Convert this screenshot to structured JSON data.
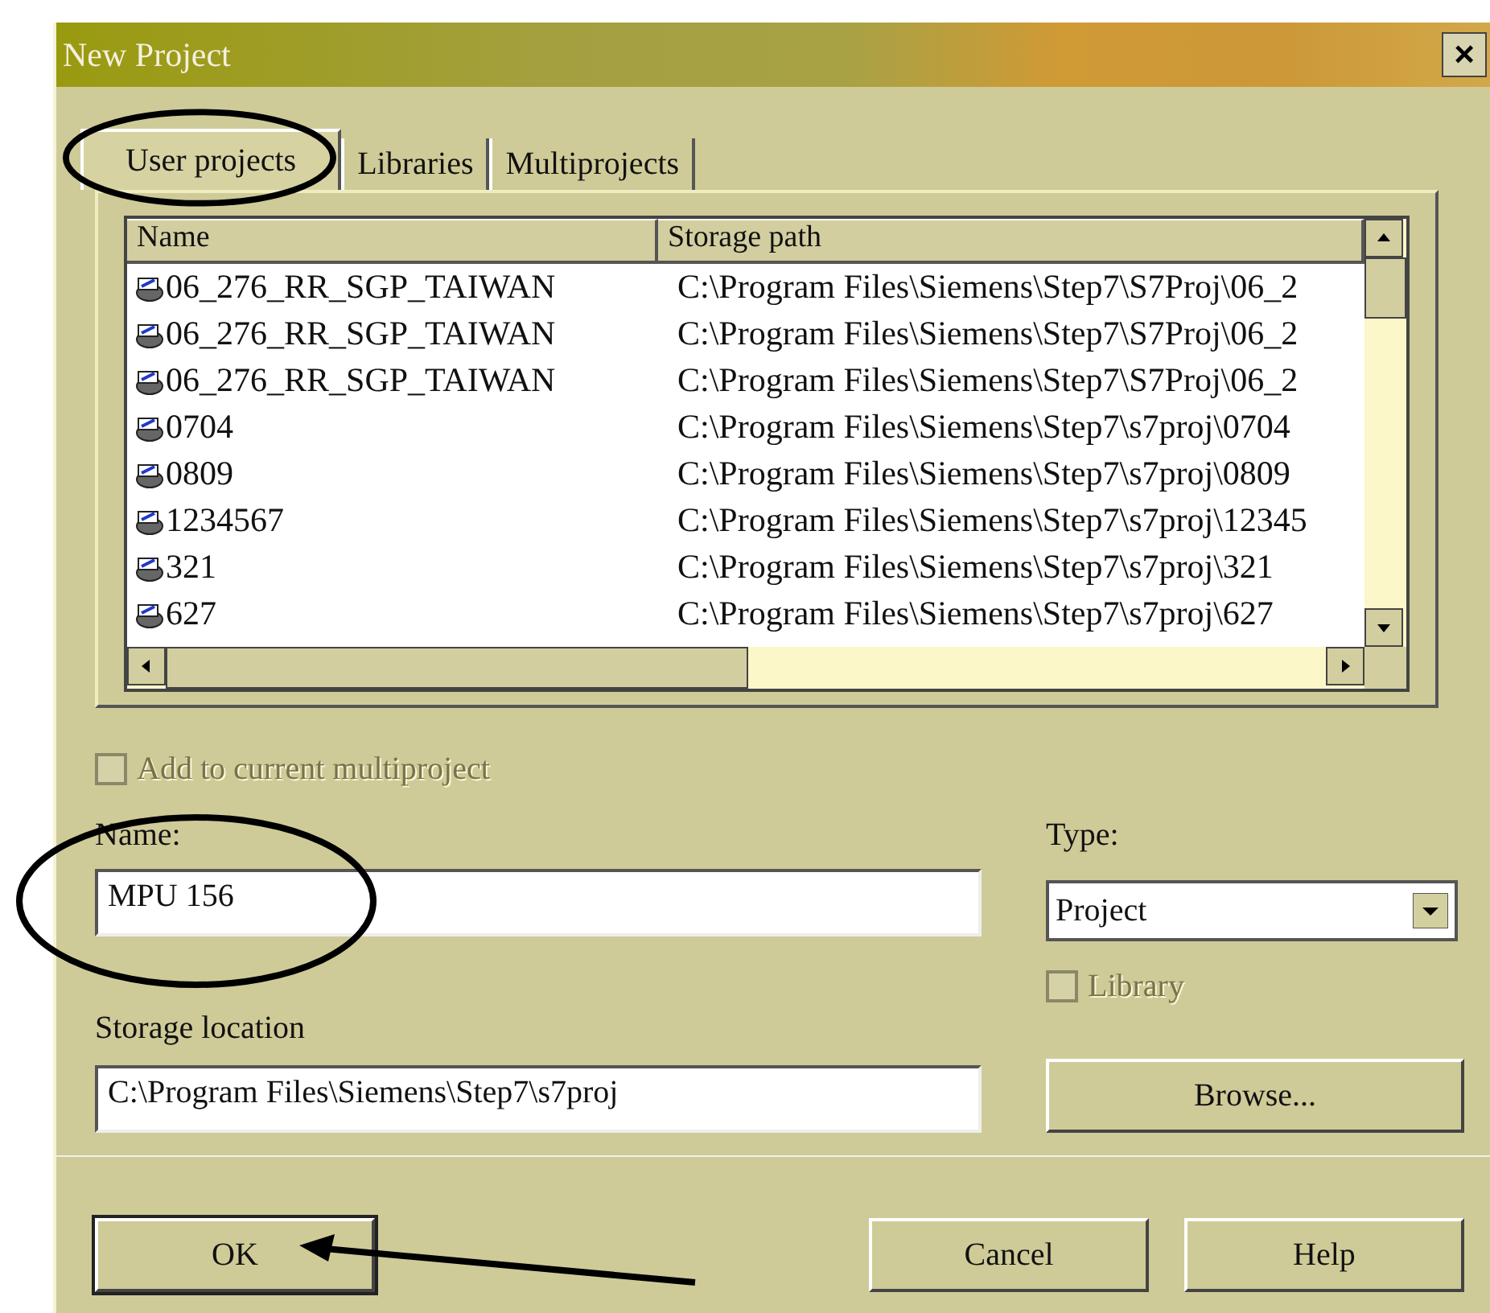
{
  "window": {
    "title": "New Project",
    "close": "×"
  },
  "tabs": [
    {
      "label": "User projects",
      "selected": true
    },
    {
      "label": "Libraries",
      "selected": false
    },
    {
      "label": "Multiprojects",
      "selected": false
    }
  ],
  "table": {
    "columns": [
      "Name",
      "Storage path"
    ],
    "rows": [
      {
        "name": "06_276_RR_SGP_TAIWAN",
        "path": "C:\\Program Files\\Siemens\\Step7\\S7Proj\\06_2"
      },
      {
        "name": "06_276_RR_SGP_TAIWAN",
        "path": "C:\\Program Files\\Siemens\\Step7\\S7Proj\\06_2"
      },
      {
        "name": "06_276_RR_SGP_TAIWAN",
        "path": "C:\\Program Files\\Siemens\\Step7\\S7Proj\\06_2"
      },
      {
        "name": "0704",
        "path": "C:\\Program Files\\Siemens\\Step7\\s7proj\\0704"
      },
      {
        "name": "0809",
        "path": "C:\\Program Files\\Siemens\\Step7\\s7proj\\0809"
      },
      {
        "name": "1234567",
        "path": "C:\\Program Files\\Siemens\\Step7\\s7proj\\12345"
      },
      {
        "name": "321",
        "path": "C:\\Program Files\\Siemens\\Step7\\s7proj\\321"
      },
      {
        "name": "627",
        "path": "C:\\Program Files\\Siemens\\Step7\\s7proj\\627"
      }
    ]
  },
  "add_to_multiproject": {
    "label": "Add to current multiproject",
    "checked": false,
    "disabled": true
  },
  "name_field": {
    "label": "Name:",
    "value": "MPU 156"
  },
  "type_field": {
    "label": "Type:",
    "value": "Project"
  },
  "library": {
    "label": "Library",
    "checked": false,
    "disabled": true
  },
  "storage_location": {
    "label": "Storage location",
    "value": "C:\\Program Files\\Siemens\\Step7\\s7proj"
  },
  "browse_button": "Browse...",
  "buttons": [
    "OK",
    "Cancel",
    "Help"
  ]
}
